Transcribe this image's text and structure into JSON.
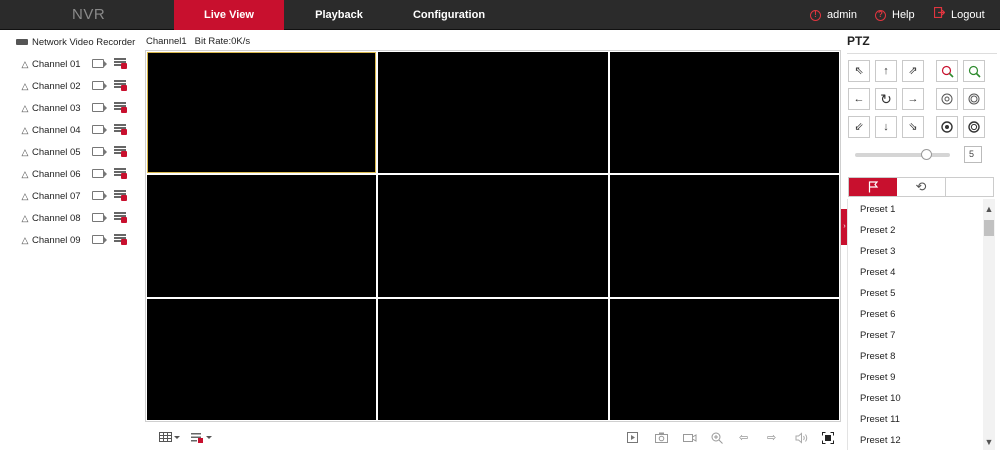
{
  "header": {
    "brand": "NVR",
    "tabs": [
      {
        "label": "Live View",
        "active": true
      },
      {
        "label": "Playback",
        "active": false
      },
      {
        "label": "Configuration",
        "active": false
      }
    ],
    "user": "admin",
    "help": "Help",
    "logout": "Logout"
  },
  "sidebar": {
    "device": "Network Video Recorder",
    "channels": [
      "Channel 01",
      "Channel 02",
      "Channel 03",
      "Channel 04",
      "Channel 05",
      "Channel 06",
      "Channel 07",
      "Channel 08",
      "Channel 09"
    ]
  },
  "status": {
    "channel": "Channel1",
    "bitrate": "Bit Rate:0K/s"
  },
  "ptz": {
    "title": "PTZ",
    "speed": "5",
    "speed_level": 0.75,
    "presets": [
      "Preset 1",
      "Preset 2",
      "Preset 3",
      "Preset 4",
      "Preset 5",
      "Preset 6",
      "Preset 7",
      "Preset 8",
      "Preset 9",
      "Preset 10",
      "Preset 11",
      "Preset 12"
    ]
  },
  "icons": {
    "alert": "user-icon",
    "help": "help-icon",
    "logout": "logout-icon"
  },
  "colors": {
    "accent": "#c8102e",
    "topbar": "#2b2b2b",
    "selected_border": "#d7b64a"
  }
}
